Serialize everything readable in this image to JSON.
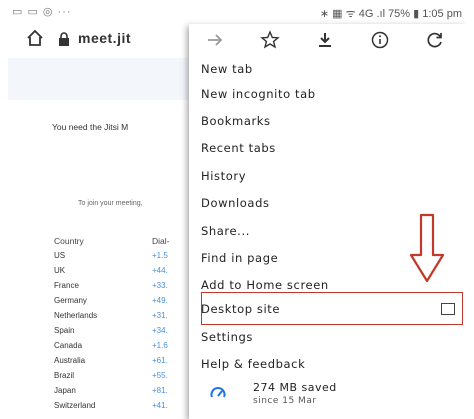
{
  "status_bar": {
    "left_icons": "▭ ▭ ◎ ···",
    "right_text": "∗ ▦ ᯤ 4G .ıl 75% ▮ 1:05 pm"
  },
  "toolbar": {
    "url": "meet.jit"
  },
  "page": {
    "need_text": "You need the Jitsi M",
    "join_text": "To join your meeting,",
    "country_header": "Country",
    "dial_header": "Dial-",
    "rows": [
      {
        "country": "US",
        "number": "+1.5"
      },
      {
        "country": "UK",
        "number": "+44."
      },
      {
        "country": "France",
        "number": "+33."
      },
      {
        "country": "Germany",
        "number": "+49."
      },
      {
        "country": "Netherlands",
        "number": "+31."
      },
      {
        "country": "Spain",
        "number": "+34."
      },
      {
        "country": "Canada",
        "number": "+1.6"
      },
      {
        "country": "Australia",
        "number": "+61."
      },
      {
        "country": "Brazil",
        "number": "+55."
      },
      {
        "country": "Japan",
        "number": "+81."
      },
      {
        "country": "Switzerland",
        "number": "+41."
      }
    ]
  },
  "menu": {
    "icons": [
      "forward-icon",
      "star-icon",
      "download-icon",
      "info-icon",
      "refresh-icon"
    ],
    "items": [
      {
        "label": "New tab"
      },
      {
        "label": "New incognito tab"
      },
      {
        "label": "Bookmarks"
      },
      {
        "label": "Recent tabs"
      },
      {
        "label": "History"
      },
      {
        "label": "Downloads"
      },
      {
        "label": "Share..."
      },
      {
        "label": "Find in page"
      },
      {
        "label": "Add to Home screen"
      },
      {
        "label": "Desktop site"
      },
      {
        "label": "Settings"
      },
      {
        "label": "Help & feedback"
      }
    ],
    "saved": {
      "amount": "274 MB saved",
      "since": "since 15 Mar"
    }
  },
  "colors": {
    "highlight": "#c0392b",
    "dial_number": "#4a90d9",
    "saved_icon": "#1a73e8"
  }
}
